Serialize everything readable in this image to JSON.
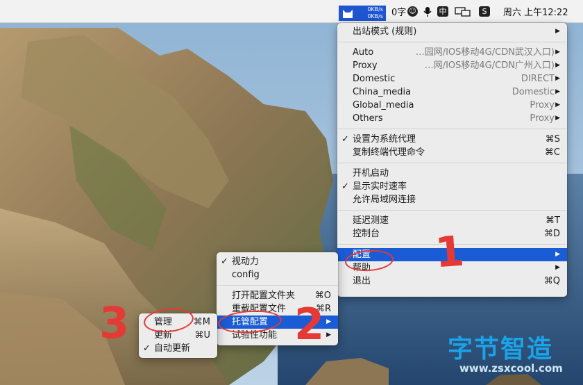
{
  "menubar": {
    "speed_up": "0KB/s",
    "speed_down": "0KB/s",
    "char_count": "0字",
    "ime_label": "中",
    "s_icon_label": "S",
    "clock": "周六 上午12:22"
  },
  "main_menu": {
    "outbound_mode": "出站模式 (规则)",
    "proxy_groups": [
      {
        "name": "Auto",
        "detail": "…园网/IOS移动4G/CDN武汉入口)"
      },
      {
        "name": "Proxy",
        "detail": "…网/IOS移动4G/CDN广州入口)"
      },
      {
        "name": "Domestic",
        "detail": "DIRECT"
      },
      {
        "name": "China_media",
        "detail": "Domestic"
      },
      {
        "name": "Global_media",
        "detail": "Proxy"
      },
      {
        "name": "Others",
        "detail": "Proxy"
      }
    ],
    "set_system_proxy": "设置为系统代理",
    "set_system_proxy_shortcut": "⌘S",
    "copy_terminal_cmd": "复制终端代理命令",
    "copy_terminal_cmd_shortcut": "⌘C",
    "launch_at_login": "开机启动",
    "show_speed": "显示实时速率",
    "allow_lan": "允许局域网连接",
    "latency_test": "延迟测速",
    "latency_test_shortcut": "⌘T",
    "dashboard": "控制台",
    "dashboard_shortcut": "⌘D",
    "config": "配置",
    "help": "帮助",
    "quit": "退出",
    "quit_shortcut": "⌘Q"
  },
  "config_submenu": {
    "profiles": [
      "视动力",
      "config"
    ],
    "open_config_folder": "打开配置文件夹",
    "open_config_folder_shortcut": "⌘O",
    "reload_config": "重载配置文件",
    "reload_config_shortcut": "⌘R",
    "managed_config": "托管配置",
    "experimental": "试验性功能"
  },
  "managed_submenu": {
    "manage": "管理",
    "manage_shortcut": "⌘M",
    "update": "更新",
    "update_shortcut": "⌘U",
    "auto_update": "自动更新"
  },
  "annotations": {
    "step1": "1",
    "step2": "2",
    "step3": "3"
  },
  "watermark": {
    "title": "字节智造",
    "url": "www.zsxcool.com"
  },
  "colors": {
    "highlight": "#1a5bd6",
    "annotation_red": "#e53935",
    "watermark_blue": "#1aa3e8"
  }
}
